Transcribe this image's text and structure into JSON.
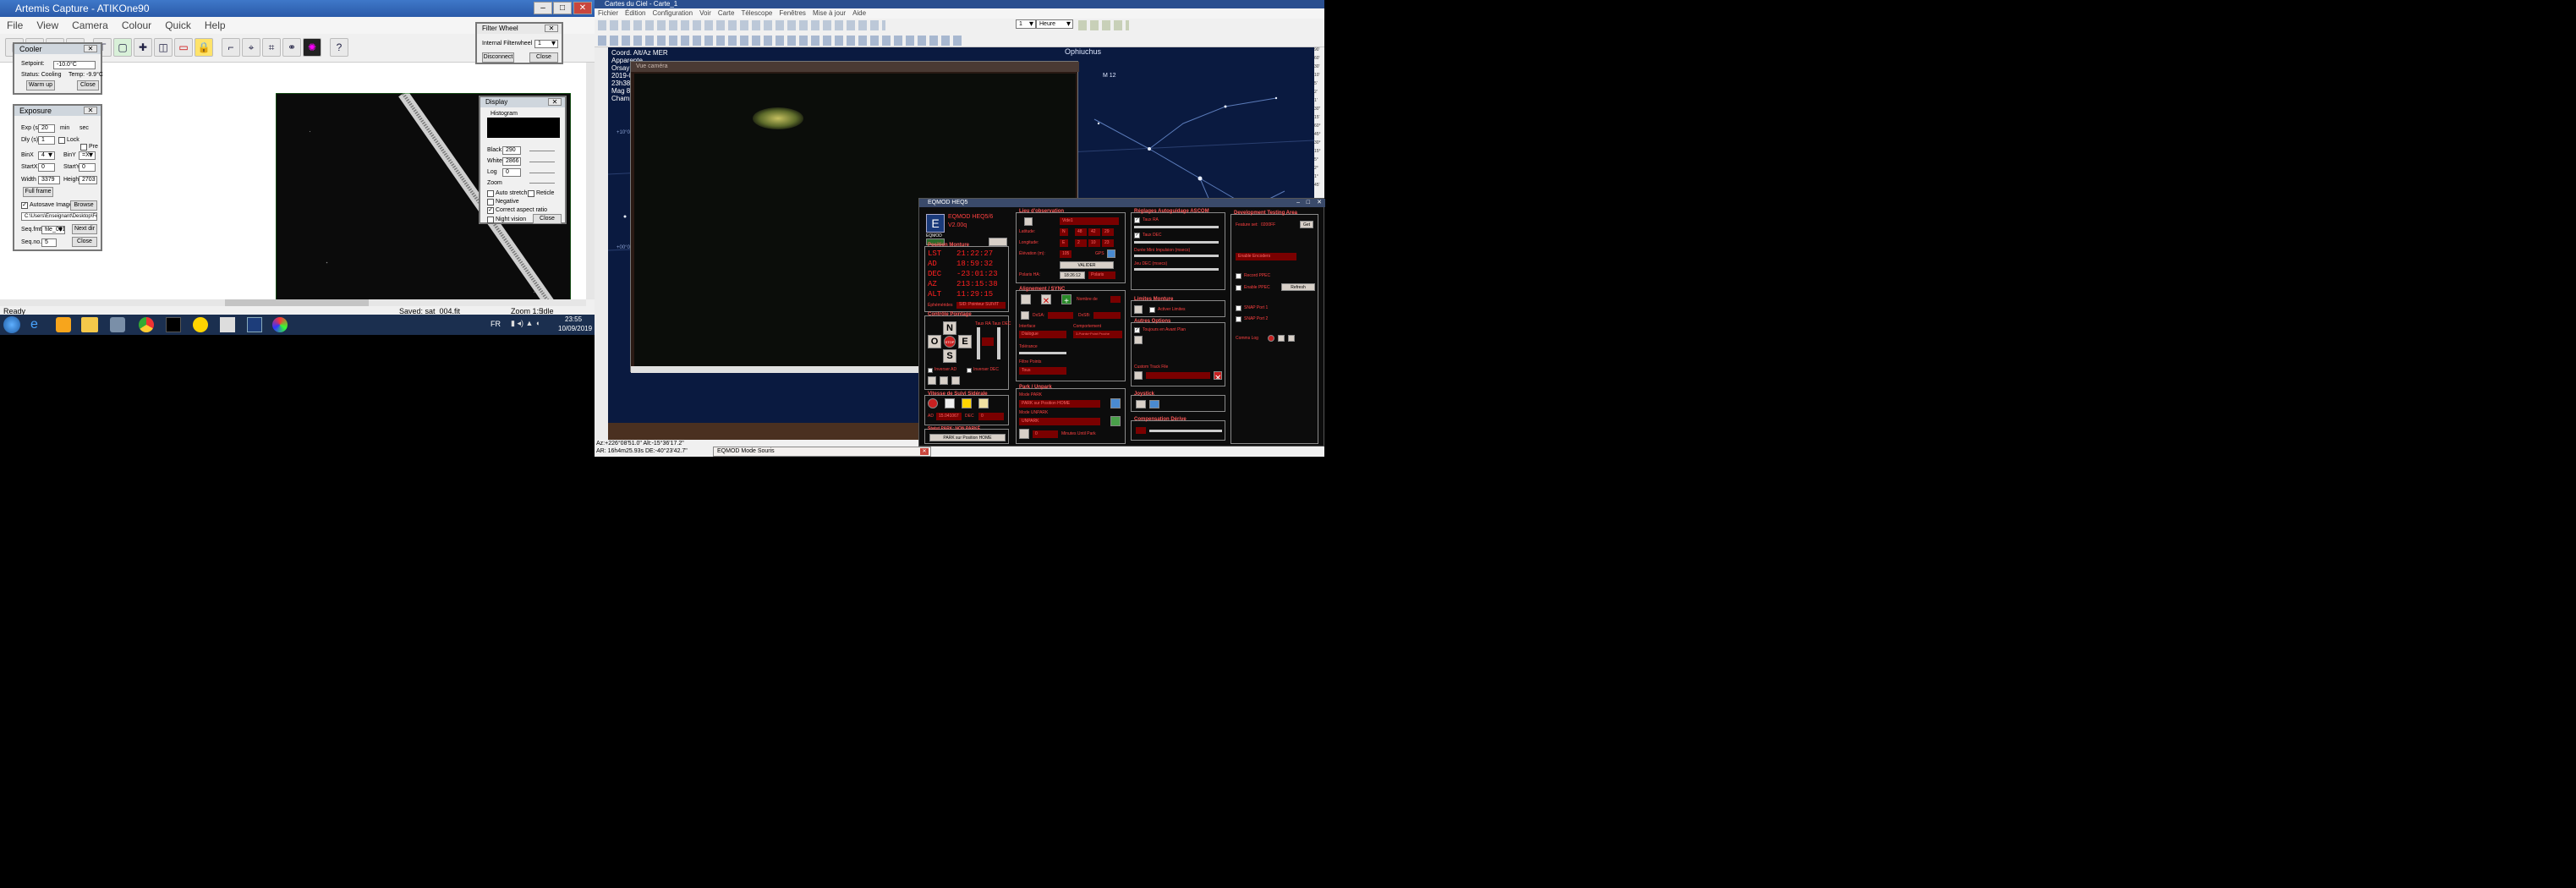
{
  "artemis": {
    "title": "Artemis Capture - ATIKOne90",
    "menu": [
      "File",
      "View",
      "Camera",
      "Colour",
      "Quick",
      "Help"
    ],
    "cooler": {
      "title": "Cooler",
      "setpoint_label": "Setpoint:",
      "setpoint_value": "-10.0°C",
      "status_label": "Status: Cooling",
      "temp_label": "Temp: -9.9°C",
      "warmup": "Warm up",
      "close": "Close"
    },
    "exposure": {
      "title": "Exposure",
      "exp_label": "Exp (s)",
      "exp_value": "20",
      "min_label": "min",
      "sec_label": "sec",
      "dly_label": "Dly (s)",
      "dly_value": "1",
      "lock_label": "Lock",
      "pre_label": "Pre",
      "binx_label": "BinX",
      "binx_value": "4",
      "biny_label": "BinY",
      "biny_value": "=X",
      "startx_label": "StartX",
      "startx_value": "0",
      "starty_label": "StartY",
      "starty_value": "0",
      "width_label": "Width",
      "width_value": "3379",
      "height_label": "Height",
      "height_value": "2703",
      "fullframe": "Full frame",
      "autosave_label": "Autosave Images",
      "browse": "Browse ...",
      "path": "C:\\Users\\Enseignant\\Desktop\\Fo",
      "seqfmt_label": "Seq.fmt",
      "seqfmt_value": "file_001",
      "nextdir": "Next dir",
      "seqno_label": "Seq.no.",
      "seqno_value": "5",
      "close": "Close"
    },
    "filterwheel": {
      "title": "Filter Wheel",
      "internal_label": "Internal Filterwheel",
      "internal_value": "1",
      "disconnect": "Disconnect",
      "close": "Close"
    },
    "display": {
      "title": "Display",
      "histogram_label": "Histogram",
      "black_label": "Black",
      "black_value": "290",
      "white_label": "White",
      "white_value": "2866",
      "log_label": "Log",
      "log_value": "0",
      "zoom_label": "Zoom",
      "autostretch": "Auto stretch",
      "reticle": "Reticle",
      "negative": "Negative",
      "correct_aspect": "Correct aspect ratio",
      "night_vision": "Night vision",
      "close": "Close"
    },
    "status": {
      "ready": "Ready",
      "saved": "Saved: sat_004.fit",
      "zoom": "Zoom 1:5",
      "idle": "Idle"
    }
  },
  "taskbar": {
    "lang": "FR",
    "time": "23:55",
    "date": "10/09/2019"
  },
  "cdc": {
    "title": "Cartes du Ciel - Carte_1",
    "menu": [
      "Fichier",
      "Édition",
      "Configuration",
      "Voir",
      "Carte",
      "Télescope",
      "Fenêtres",
      "Mise à jour",
      "Aide"
    ],
    "time_step": "1",
    "time_unit": "Heure",
    "info_lines": [
      "Coord. Alt/Az MER",
      "Apparente",
      "Orsay",
      "2019-09",
      "23h38m",
      "Mag 8,6",
      "Champ"
    ],
    "constellation": "Ophiuchus",
    "object": "M 12",
    "grid_labels": [
      "+10°00'",
      "+00°00'"
    ],
    "scale_labels": [
      "90'",
      "60'",
      "30'",
      "10'",
      "5'",
      "2'",
      "1'",
      "30\"",
      "15'",
      "60°",
      "45°",
      "30°",
      "15°",
      "5°",
      "2°",
      "1°",
      "45'"
    ],
    "coords1": "Az:+226°08'51.0\" Alt:-15°36'17.2\"",
    "coords2": "AR: 16h4m25.93s DE:-40°23'42.7\"",
    "camera_window": "Vue caméra",
    "mouse_mode": "EQMOD Mode Souris"
  },
  "eqmod": {
    "title": "EQMOD HEQ5",
    "logo": "EQMOD",
    "version_line1": "EQMOD HEQ5/6",
    "version_line2": "V2.00q",
    "position_title": "Position Monture",
    "lst_label": "LST",
    "lst": "21:22:27",
    "ad_label": "AD",
    "ad": "18:59:32",
    "dec_label": "DEC",
    "dec": "-23:01:23",
    "az_label": "AZ",
    "az": "213:15:38",
    "alt_label": "ALT",
    "alt": "11:29:15",
    "ephem_label": "Éphémérides",
    "ephem_value": "SID: Pointeur SUIVIT",
    "control_title": "Contrôle Pointage",
    "n": "N",
    "o": "O",
    "e": "E",
    "s": "S",
    "stop": "STOP",
    "rate_ra": "Taux RA",
    "rate_dec": "Taux DEC",
    "inv_ad": "Inverser AD",
    "inv_dec": "Inverser DEC",
    "speed_title": "Vitesse de Suivi Sidérale",
    "speed_ad_label": "AD",
    "speed_ad": "15.041067",
    "speed_dec_label": "DEC",
    "speed_dec": "0",
    "park_status": "Statut PARK: NON PARKÉ",
    "park_button": "PARK sur Position HOME",
    "site_title": "Lieu d'observation",
    "site_value": "Vide1",
    "lat_label": "Latitude:",
    "lat": [
      "N",
      "48",
      "42",
      "29"
    ],
    "lon_label": "Longitude:",
    "lon": [
      "E",
      "2",
      "10",
      "23"
    ],
    "elev_label": "Élévation (m):",
    "elev": "105",
    "gps": "GPS",
    "validate": "VALIDER",
    "polaris_label": "Polaris HA:",
    "polaris_time": "18:26:12",
    "polaris_mode": "Polaris",
    "align_title": "Alignement / SYNC",
    "nb_points": "Nombre de",
    "dxsa": "DxSA:",
    "dxsb": "DxSB:",
    "interface_label": "Interface",
    "interface_value": "Dialogue",
    "behavior_label": "Comportement",
    "behavior_value": "3-Points+Point Proche",
    "tolerance_label": "Tolérance",
    "filter_label": "Filtre Points",
    "filter_value": "Tous",
    "parkunpark_title": "Park / Unpark",
    "mode_park": "Mode PARK",
    "mode_park_value": "PARK sur Position HOME",
    "mode_unpark": "Mode UNPARK",
    "mode_unpark_value": "UNPARK",
    "minutes_label": "Minutes Until Park",
    "minutes_value": "0",
    "ascom_title": "Réglages Autoguidage ASCOM",
    "taux_ra": "Taux RA",
    "taux_dec": "Taux DEC",
    "pulse_label": "Durée Mini Impulsion (msecs)",
    "backlash_label": "Jeu DEC (msecs)",
    "limits_title": "Limites Monture",
    "limits_enable": "Activer Limites",
    "other_title": "Autres Options",
    "always_ahead": "Toujours en Avant Plan",
    "custom_track": "Custom Track File",
    "joystick_title": "Joystick",
    "drift_title": "Compensation Dérive",
    "dev_title": "Development Testing Area",
    "feature_label": "Feature set:",
    "feature_value": "0200FF",
    "get": "Get",
    "encoders_value": "Enable Encoders",
    "record_ppec": "Record PPEC",
    "enable_ppec": "Enable PPEC",
    "refresh": "Refresh",
    "snap1": "SNAP Port 1",
    "snap2": "SNAP Port 2",
    "comms_log": "Comms Log"
  },
  "colors": {
    "titlebar": "#2a5aa8",
    "eqmod_red": "#ff2020",
    "eqmod_field": "#7a0000",
    "sky": "#0a1a40"
  }
}
